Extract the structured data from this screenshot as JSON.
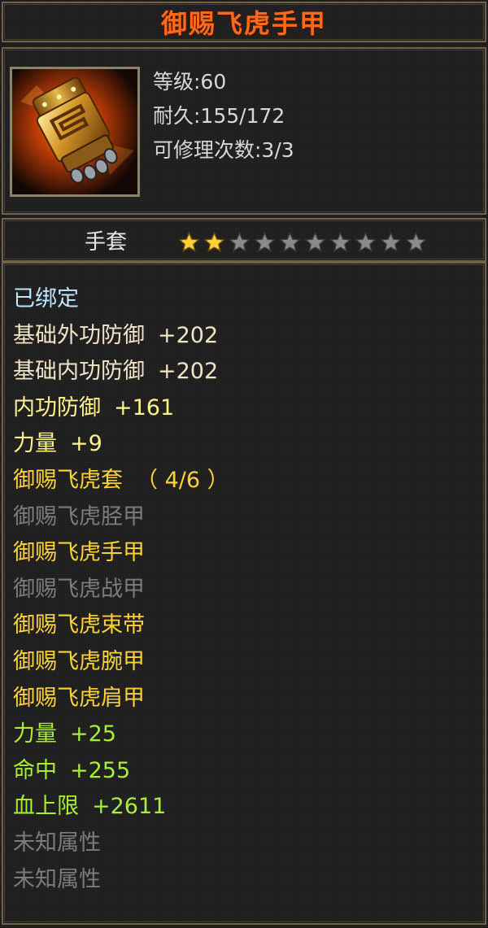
{
  "item": {
    "name": "御赐飞虎手甲",
    "level": "等级:60",
    "durability": "耐久:155/172",
    "repair": "可修理次数:3/3",
    "type": "手套",
    "star_rating": {
      "filled": 2,
      "total": 10
    }
  },
  "attributes": {
    "bound": "已绑定",
    "base_outer_def": {
      "label": "基础外功防御",
      "value": "+202"
    },
    "base_inner_def": {
      "label": "基础内功防御",
      "value": "+202"
    },
    "inner_def": {
      "label": "内功防御",
      "value": "+161"
    },
    "strength": {
      "label": "力量",
      "value": "+9"
    }
  },
  "set": {
    "name": "御赐飞虎套",
    "progress": "（ 4/6 ）",
    "pieces": [
      {
        "name": "御赐飞虎胫甲",
        "owned": false
      },
      {
        "name": "御赐飞虎手甲",
        "owned": true
      },
      {
        "name": "御赐飞虎战甲",
        "owned": false
      },
      {
        "name": "御赐飞虎束带",
        "owned": true
      },
      {
        "name": "御赐飞虎腕甲",
        "owned": true
      },
      {
        "name": "御赐飞虎肩甲",
        "owned": true
      }
    ],
    "bonuses": [
      {
        "label": "力量",
        "value": "+25"
      },
      {
        "label": "命中",
        "value": "+255"
      },
      {
        "label": "血上限",
        "value": "+2611"
      }
    ],
    "unknown": [
      "未知属性",
      "未知属性"
    ]
  },
  "colors": {
    "title": "#ff6a1a",
    "owned_piece": "#ffd23c",
    "missing_piece": "#7c7c7c",
    "bonus": "#a8ee38",
    "bound": "#bfe8ff"
  },
  "icons": {
    "item": "gauntlet-icon",
    "star": "star-icon"
  }
}
